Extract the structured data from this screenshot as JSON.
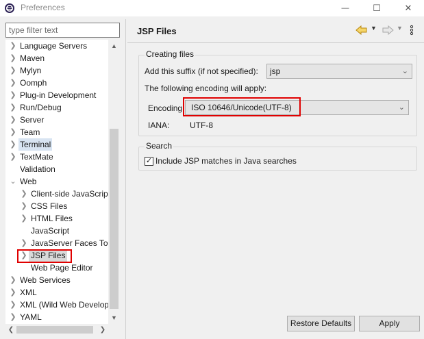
{
  "window": {
    "title": "Preferences",
    "minimize_glyph": "—",
    "maximize_glyph": "☐",
    "close_glyph": "✕"
  },
  "filter": {
    "placeholder": "type filter text"
  },
  "tree": {
    "items": [
      {
        "label": "Language Servers",
        "expandable": true,
        "level": 0
      },
      {
        "label": "Maven",
        "expandable": true,
        "level": 0
      },
      {
        "label": "Mylyn",
        "expandable": true,
        "level": 0
      },
      {
        "label": "Oomph",
        "expandable": true,
        "level": 0
      },
      {
        "label": "Plug-in Development",
        "expandable": true,
        "level": 0
      },
      {
        "label": "Run/Debug",
        "expandable": true,
        "level": 0
      },
      {
        "label": "Server",
        "expandable": true,
        "level": 0
      },
      {
        "label": "Team",
        "expandable": true,
        "level": 0
      },
      {
        "label": "Terminal",
        "expandable": true,
        "level": 0
      },
      {
        "label": "TextMate",
        "expandable": true,
        "level": 0
      },
      {
        "label": "Validation",
        "expandable": false,
        "level": 0
      },
      {
        "label": "Web",
        "expandable": true,
        "expanded": true,
        "level": 0
      },
      {
        "label": "Client-side JavaScript",
        "expandable": true,
        "level": 1
      },
      {
        "label": "CSS Files",
        "expandable": true,
        "level": 1
      },
      {
        "label": "HTML Files",
        "expandable": true,
        "level": 1
      },
      {
        "label": "JavaScript",
        "expandable": false,
        "level": 1
      },
      {
        "label": "JavaServer Faces Tools",
        "expandable": true,
        "level": 1
      },
      {
        "label": "JSP Files",
        "expandable": true,
        "level": 1,
        "selected": true
      },
      {
        "label": "Web Page Editor",
        "expandable": false,
        "level": 1
      },
      {
        "label": "Web Services",
        "expandable": true,
        "level": 0
      },
      {
        "label": "XML",
        "expandable": true,
        "level": 0
      },
      {
        "label": "XML (Wild Web Developer)",
        "expandable": true,
        "level": 0
      },
      {
        "label": "YAML",
        "expandable": true,
        "level": 0
      }
    ]
  },
  "page": {
    "title": "JSP Files",
    "back_icon": "back-arrow-icon",
    "forward_icon": "forward-arrow-icon",
    "menu_icon": "view-menu-icon"
  },
  "creating_files": {
    "group_label": "Creating files",
    "suffix_label": "Add this suffix (if not specified):",
    "suffix_value": "jsp",
    "encoding_note": "The following encoding will apply:",
    "encoding_label": "Encoding:",
    "encoding_value": "ISO 10646/Unicode(UTF-8)",
    "iana_label": "IANA:",
    "iana_value": "UTF-8"
  },
  "search": {
    "group_label": "Search",
    "checkbox_label": "Include JSP matches in Java searches",
    "checked": true
  },
  "buttons": {
    "restore_defaults": "Restore Defaults",
    "apply": "Apply"
  },
  "colors": {
    "highlight_box": "#e00000",
    "terminal_highlight": "#d8e4f2",
    "selection": "#d9d9d9"
  }
}
